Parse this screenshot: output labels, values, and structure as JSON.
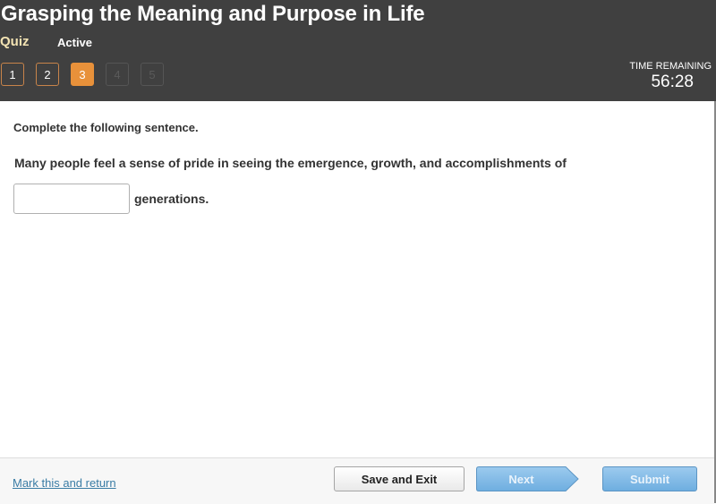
{
  "header": {
    "title": "Grasping the Meaning and Purpose in Life",
    "type_label": "Quiz",
    "status": "Active",
    "questions": [
      {
        "label": "1",
        "state": "visited"
      },
      {
        "label": "2",
        "state": "visited"
      },
      {
        "label": "3",
        "state": "current"
      },
      {
        "label": "4",
        "state": "locked"
      },
      {
        "label": "5",
        "state": "locked"
      }
    ],
    "timer_label": "TIME REMAINING",
    "timer_value": "56:28"
  },
  "question": {
    "instruction": "Complete the following sentence.",
    "sentence_before": "Many people feel a sense of pride in seeing the emergence, growth, and accomplishments of",
    "answer_value": "",
    "sentence_after": "generations."
  },
  "footer": {
    "mark_link": "Mark this and return",
    "save_label": "Save and Exit",
    "next_label": "Next",
    "submit_label": "Submit"
  },
  "colors": {
    "header_bg": "#404040",
    "accent_orange": "#e8913a",
    "quiz_label": "#f3e3b3",
    "button_blue": "#7db8e6",
    "link_blue": "#3a7ca5"
  }
}
